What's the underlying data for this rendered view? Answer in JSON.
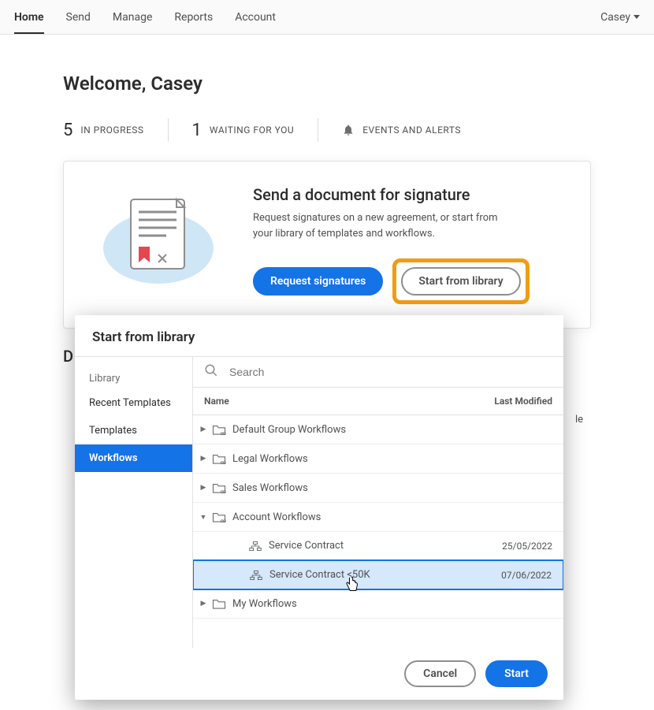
{
  "nav": {
    "tabs": [
      "Home",
      "Send",
      "Manage",
      "Reports",
      "Account"
    ],
    "active": "Home",
    "user": "Casey"
  },
  "welcome": "Welcome, Casey",
  "stats": {
    "in_progress_count": "5",
    "in_progress_label": "IN PROGRESS",
    "waiting_count": "1",
    "waiting_label": "WAITING FOR YOU",
    "events_label": "EVENTS AND ALERTS"
  },
  "card": {
    "title": "Send a document for signature",
    "subtitle": "Request signatures on a new agreement, or start from your library of templates and workflows.",
    "request_btn": "Request signatures",
    "library_btn": "Start from library"
  },
  "truncated_heading": "D",
  "behind_text": "le",
  "modal": {
    "title": "Start from library",
    "side_heading": "Library",
    "side_items": {
      "recent": "Recent Templates",
      "templates": "Templates",
      "workflows": "Workflows"
    },
    "search_placeholder": "Search",
    "col_name": "Name",
    "col_modified": "Last Modified",
    "rows": {
      "default_group": "Default Group Workflows",
      "legal": "Legal Workflows",
      "sales": "Sales Workflows",
      "account": "Account Workflows",
      "svc_contract": "Service Contract",
      "svc_contract_date": "25/05/2022",
      "svc_contract_50k": "Service Contract <50K",
      "svc_contract_50k_date": "07/06/2022",
      "my_workflows": "My Workflows"
    },
    "cancel": "Cancel",
    "start": "Start"
  }
}
